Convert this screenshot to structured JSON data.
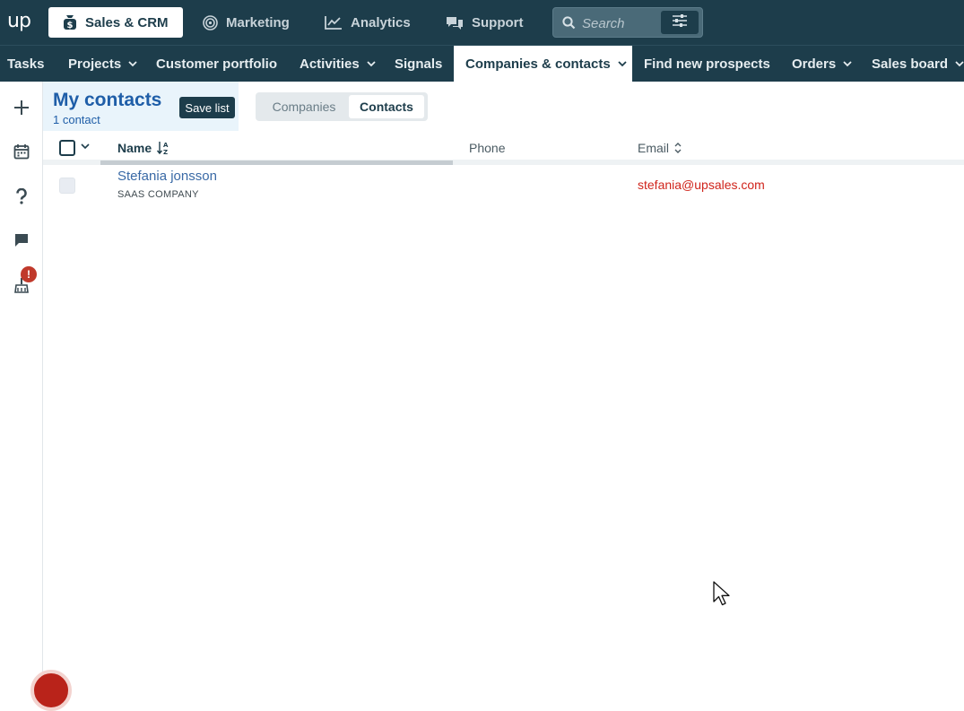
{
  "app": {
    "logo": "up",
    "colors": {
      "topbar": "#1d3d4b",
      "accent_blue": "#1f5ea8",
      "email_red": "#d0241b",
      "alert": "#c0392b"
    }
  },
  "top_tabs": [
    {
      "label": "Sales & CRM",
      "icon": "dollar-bag-icon",
      "active": true
    },
    {
      "label": "Marketing",
      "icon": "target-icon",
      "active": false
    },
    {
      "label": "Analytics",
      "icon": "line-chart-icon",
      "active": false
    },
    {
      "label": "Support",
      "icon": "chat-bubbles-icon",
      "active": false
    }
  ],
  "search": {
    "placeholder": "Search",
    "filter_icon": "sliders-icon"
  },
  "nav": {
    "items": [
      {
        "label": "Tasks",
        "dropdown": false
      },
      {
        "label": "Projects",
        "dropdown": true
      },
      {
        "label": "Customer portfolio",
        "dropdown": false
      },
      {
        "label": "Activities",
        "dropdown": true
      },
      {
        "label": "Signals",
        "dropdown": false
      },
      {
        "label": "Companies & contacts",
        "dropdown": true,
        "active": true
      },
      {
        "label": "Find new prospects",
        "dropdown": false
      },
      {
        "label": "Orders",
        "dropdown": true
      },
      {
        "label": "Sales board",
        "dropdown": true
      }
    ]
  },
  "sidebar": {
    "icons": [
      "plus-icon",
      "calendar-icon",
      "question-icon",
      "message-icon",
      "broom-icon"
    ],
    "alert_badge": "!"
  },
  "list": {
    "title": "My contacts",
    "count": "1 contact",
    "save_label": "Save list"
  },
  "segment": {
    "companies": "Companies",
    "contacts": "Contacts",
    "selected": "Contacts"
  },
  "table": {
    "columns": {
      "name": "Name",
      "phone": "Phone",
      "email": "Email"
    },
    "rows": [
      {
        "name": "Stefania jonsson",
        "company": "SAAS COMPANY",
        "phone": "",
        "email": "stefania@upsales.com"
      }
    ]
  }
}
